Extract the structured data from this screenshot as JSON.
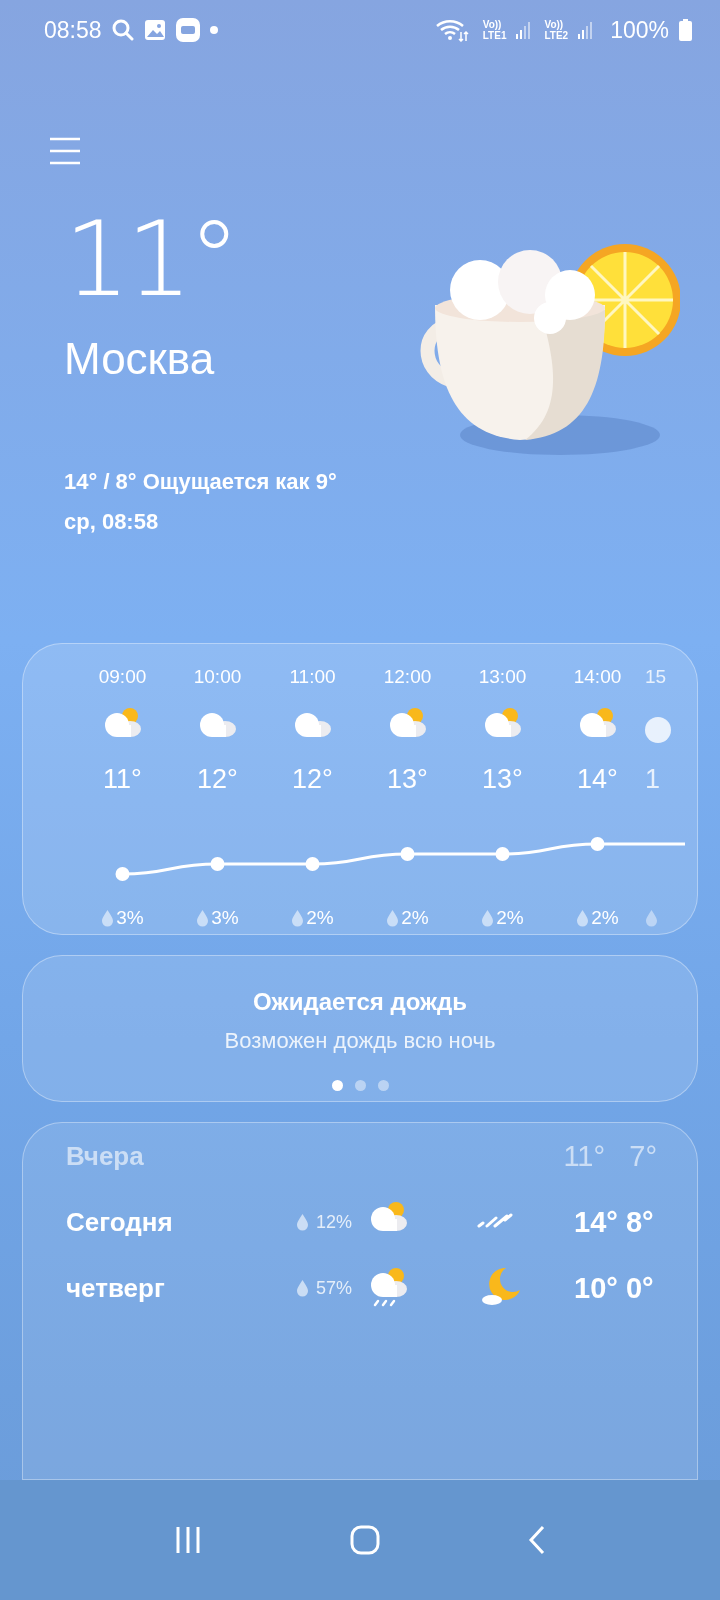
{
  "status_bar": {
    "time": "08:58",
    "sims": [
      {
        "volte": "Vo))",
        "label": "LTE1"
      },
      {
        "volte": "Vo))",
        "label": "LTE2"
      }
    ],
    "battery": "100%"
  },
  "current": {
    "temperature": "11°",
    "city": "Москва",
    "range": "14° / 8° Ощущается как 9°",
    "updated": "ср, 08:58"
  },
  "hourly": {
    "items": [
      {
        "time": "09:00",
        "kind": "partly-cloudy",
        "temp": "11°",
        "rain": "3%",
        "faded": false
      },
      {
        "time": "10:00",
        "kind": "cloudy",
        "temp": "12°",
        "rain": "3%",
        "faded": false
      },
      {
        "time": "11:00",
        "kind": "cloudy",
        "temp": "12°",
        "rain": "2%",
        "faded": false
      },
      {
        "time": "12:00",
        "kind": "partly-cloudy",
        "temp": "13°",
        "rain": "2%",
        "faded": false
      },
      {
        "time": "13:00",
        "kind": "partly-cloudy",
        "temp": "13°",
        "rain": "2%",
        "faded": false
      },
      {
        "time": "14:00",
        "kind": "partly-cloudy",
        "temp": "14°",
        "rain": "2%",
        "faded": false
      },
      {
        "time": "15",
        "kind": "cloud-edge",
        "temp": "1",
        "faded": true
      }
    ]
  },
  "alert": {
    "title": "Ожидается дождь",
    "text": "Возможен дождь всю ночь",
    "dots": [
      {
        "selected": true
      },
      {
        "selected": false
      },
      {
        "selected": false
      }
    ]
  },
  "daily": [
    {
      "kind": "past",
      "day": "Вчера",
      "high": "11°",
      "low": "7°"
    },
    {
      "kind": "forecast",
      "day": "Сегодня",
      "rain": "12%",
      "icons": [
        {
          "kind": "partly-cloudy"
        },
        {
          "kind": "drizzle"
        }
      ],
      "high": "14°",
      "low": "8°"
    },
    {
      "kind": "forecast",
      "day": "четверг",
      "rain": "57%",
      "icons": [
        {
          "kind": "rain"
        },
        {
          "kind": "moon-cloud"
        }
      ],
      "high": "10°",
      "low": "0°"
    }
  ]
}
